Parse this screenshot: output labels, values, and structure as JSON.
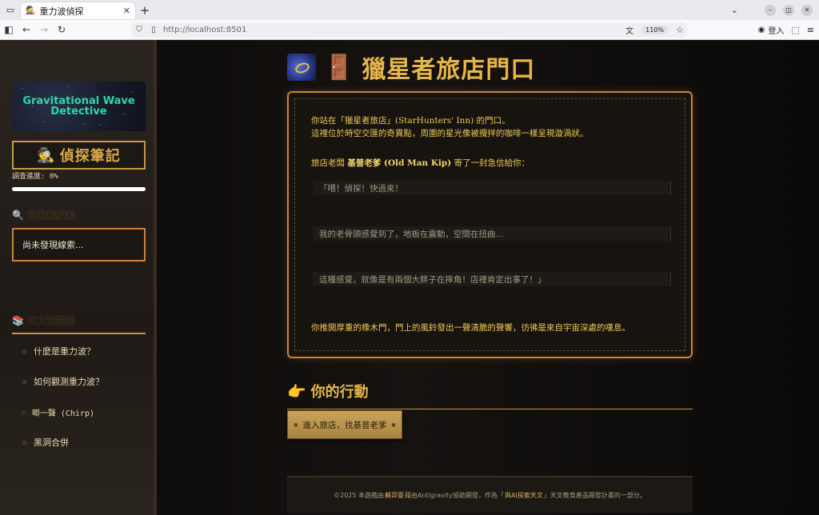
{
  "browser": {
    "tab_title": "重力波偵探",
    "tab_favicon": "🕵",
    "url": "http://localhost:8501",
    "zoom": "110%",
    "login_label": "登入"
  },
  "sidebar": {
    "logo_text": "Gravitational Wave\nDetective",
    "notebook_icon": "🕵",
    "notebook_label": "偵探筆記",
    "progress_label": "調查進度: 0%",
    "progress_value": 0,
    "clues_icon": "🔍",
    "clues_title": "已收集線索",
    "clues_empty": "尚未發現線索...",
    "kb_icon": "📚",
    "kb_title": "天文知識庫",
    "kb_items": [
      "什麼是重力波？",
      "如何觀測重力波？",
      "唧一聲 (Chirp)",
      "黑洞合併"
    ]
  },
  "main": {
    "title_icon": "🚪",
    "title": "獵星者旅店門口",
    "story": {
      "p1_line1": "你站在「獵星者旅店」(StarHunters' Inn) 的門口。",
      "p1_line2": "這裡位於時空交匯的奇異點，周圍的星光像被攪拌的咖啡一樣呈現漩渦狀。",
      "p2_prefix": "旅店老闆 ",
      "p2_name": "基普老爹 (Old Man Kip)",
      "p2_suffix": " 寄了一封急信給你：",
      "quote1": "「喂！偵探！快過來！",
      "quote2": "我的老骨頭感覺到了，地板在震動，空間在扭曲...",
      "quote3": "這種感覺，就像是有兩個大胖子在摔角！店裡肯定出事了！」",
      "p3": "你推開厚重的橡木門，門上的風鈴發出一聲清脆的聲響，彷彿是來自宇宙深處的嘆息。"
    },
    "action_icon": "👉",
    "action_title": "你的行動",
    "action_button": "進入旅店，找基普老爹"
  },
  "footer": {
    "prefix": "©2025 本遊戲由",
    "author": "蘇羿豪",
    "middle": "藉由Antigravity協助開發，作為「",
    "project": "與AI探索天文",
    "suffix": "」天文教育產品開發計畫的一部分。"
  }
}
